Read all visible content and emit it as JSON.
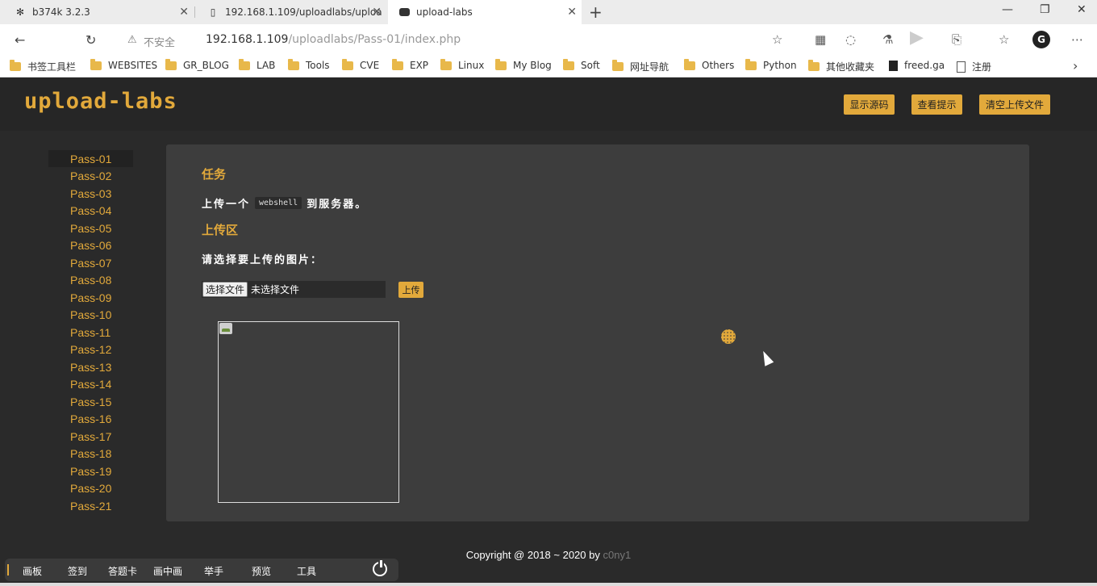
{
  "browser": {
    "tabs": [
      {
        "label": "b374k 3.2.3",
        "icon": "spider-icon"
      },
      {
        "label": "192.168.1.109/uploadlabs/uploa",
        "icon": "page-icon"
      },
      {
        "label": "upload-labs",
        "icon": "ghost-icon"
      }
    ],
    "url": {
      "prefix": "不安全",
      "host": "192.168.1.109",
      "path": "/uploadlabs/Pass-01/index.php"
    },
    "bookmarks": [
      "书签工具栏",
      "WEBSITES",
      "GR_BLOG",
      "LAB",
      "Tools",
      "CVE",
      "EXP",
      "Linux",
      "My Blog",
      "Soft",
      "网址导航",
      "Others",
      "Python",
      "其他收藏夹",
      "freed.ga",
      "注册"
    ]
  },
  "header": {
    "logo": "upload-labs",
    "buttons": {
      "show_source": "显示源码",
      "show_hint": "查看提示",
      "clear_uploads": "清空上传文件"
    }
  },
  "sidebar": {
    "items": [
      "Pass-01",
      "Pass-02",
      "Pass-03",
      "Pass-04",
      "Pass-05",
      "Pass-06",
      "Pass-07",
      "Pass-08",
      "Pass-09",
      "Pass-10",
      "Pass-11",
      "Pass-12",
      "Pass-13",
      "Pass-14",
      "Pass-15",
      "Pass-16",
      "Pass-17",
      "Pass-18",
      "Pass-19",
      "Pass-20",
      "Pass-21"
    ],
    "active": "Pass-01"
  },
  "main": {
    "task_title": "任务",
    "task_before": "上传一个",
    "task_code": "webshell",
    "task_after": "到服务器。",
    "upload_title": "上传区",
    "prompt": "请选择要上传的图片：",
    "choose_file": "选择文件",
    "no_file": "未选择文件",
    "upload_button": "上传"
  },
  "footer": {
    "text": "Copyright @ 2018 ~ 2020 by",
    "author": "c0ny1"
  },
  "overlay": {
    "items": [
      "画板",
      "签到",
      "答题卡",
      "画中画",
      "举手",
      "预览",
      "工具"
    ]
  },
  "colors": {
    "accent": "#e2a93b",
    "background": "#2a2a2a",
    "panel": "#3d3d3d"
  }
}
